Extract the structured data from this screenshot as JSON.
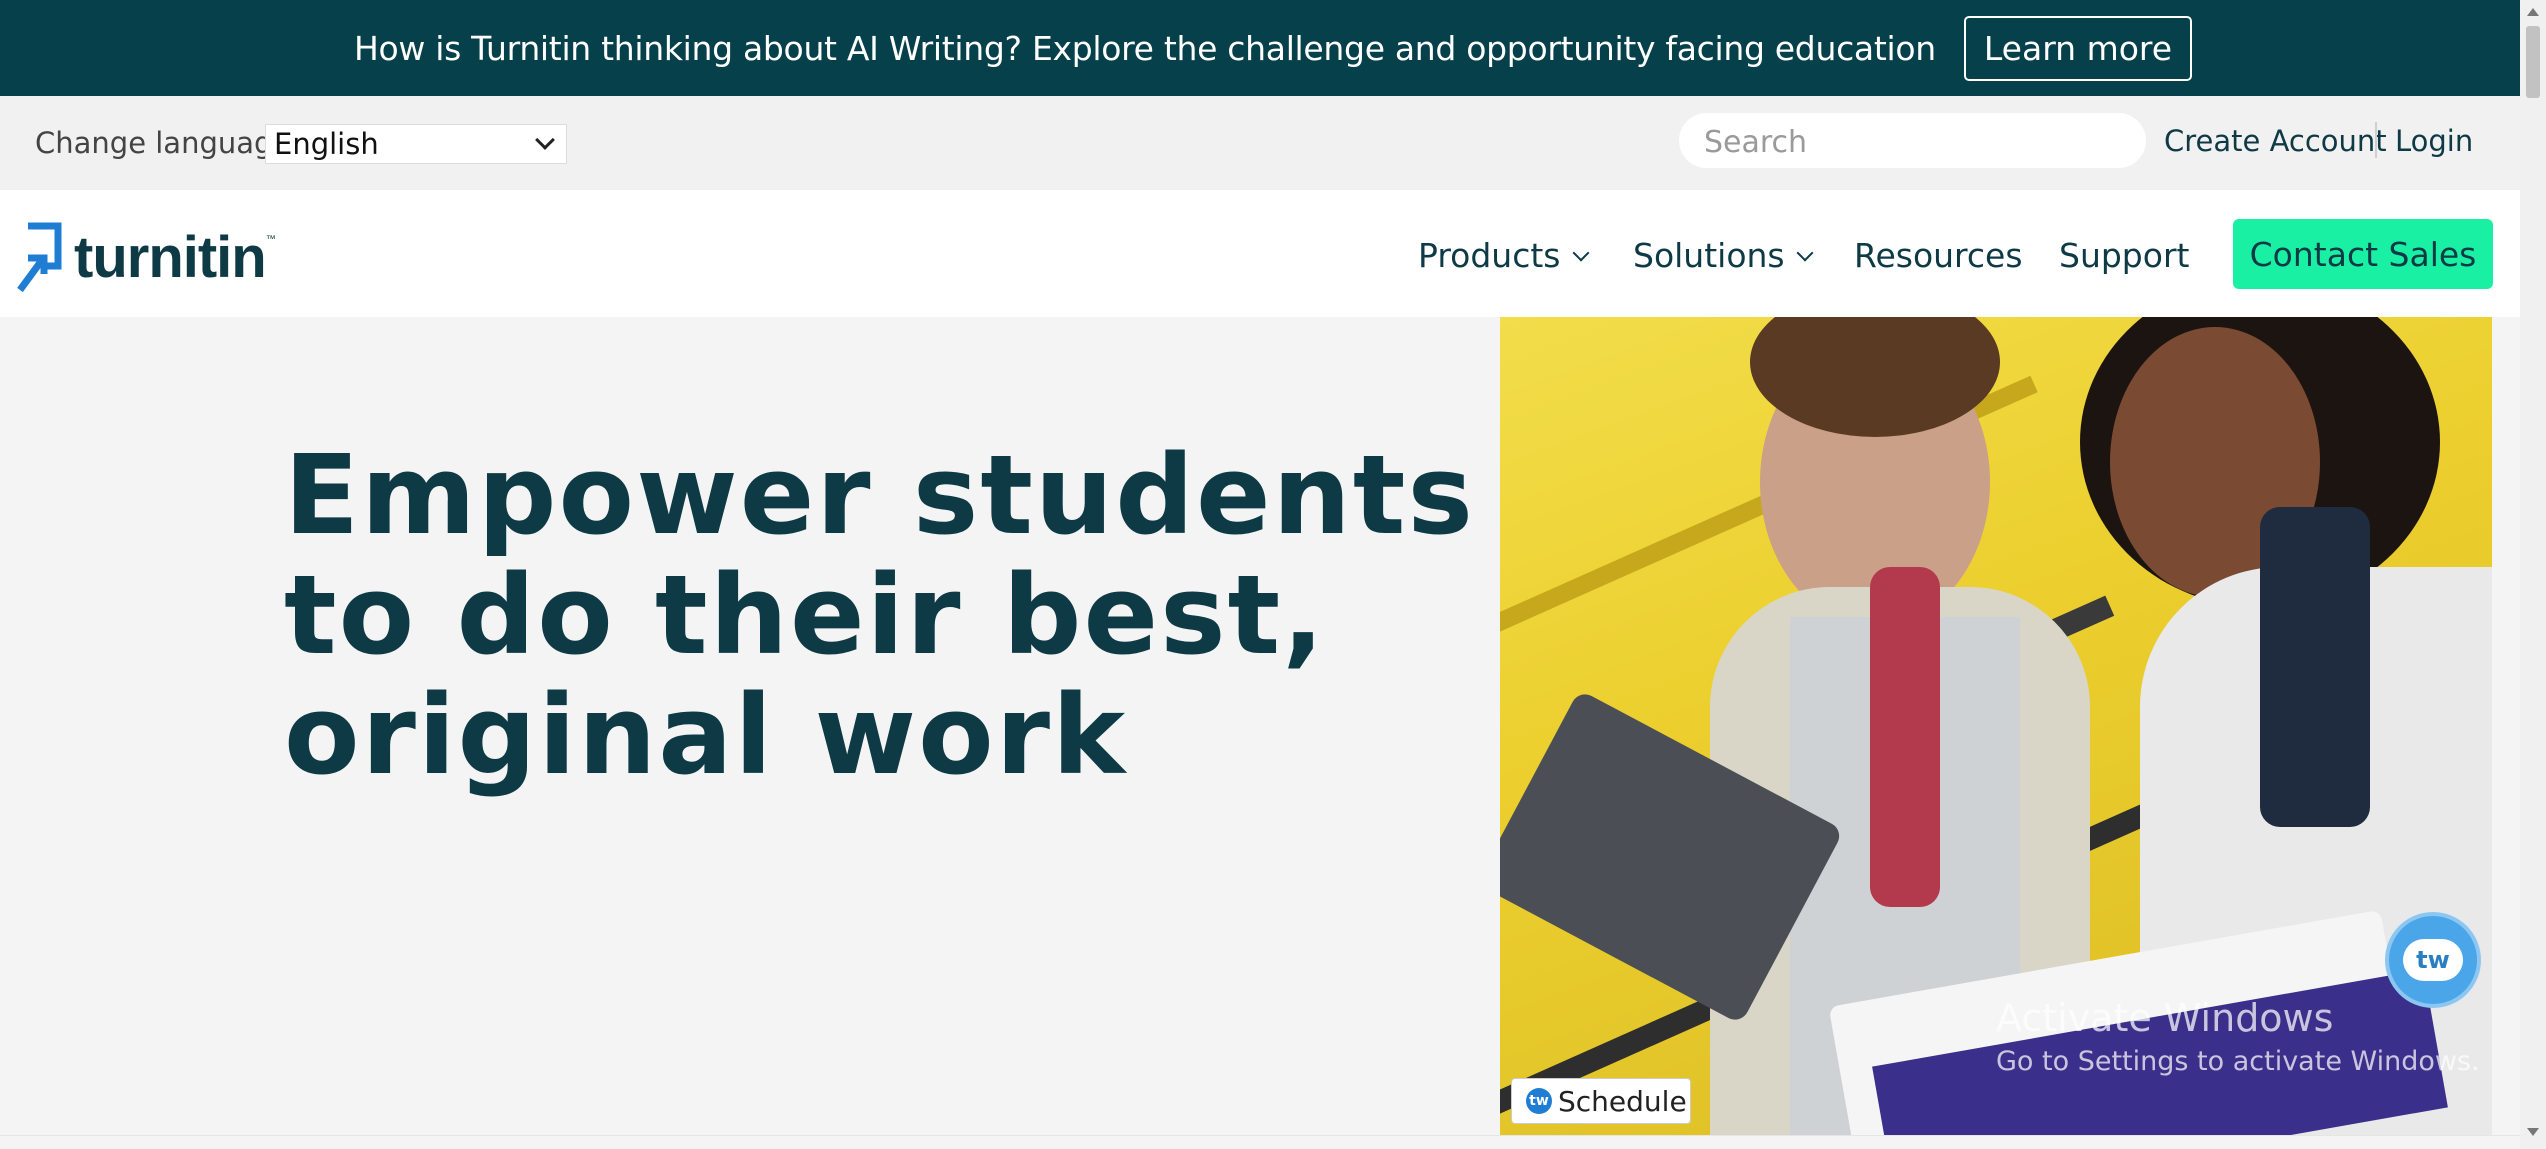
{
  "announcement": {
    "text": "How is Turnitin thinking about AI Writing? Explore the challenge and opportunity facing education",
    "button_label": "Learn more"
  },
  "utility": {
    "language_label": "Change language",
    "language_selected": "English",
    "search_placeholder": "Search",
    "create_account": "Create Account",
    "login": "Login"
  },
  "nav": {
    "logo_text": "turnitin",
    "logo_tm": "™",
    "items": [
      {
        "label": "Products",
        "has_dropdown": true
      },
      {
        "label": "Solutions",
        "has_dropdown": true
      },
      {
        "label": "Resources",
        "has_dropdown": false
      },
      {
        "label": "Support",
        "has_dropdown": false
      }
    ],
    "cta_label": "Contact Sales"
  },
  "hero": {
    "title_lines": [
      "Empower students",
      "to do their best,",
      "original work"
    ],
    "image_alt": "students-studying-photo"
  },
  "overlays": {
    "schedule_label": "Schedule",
    "schedule_badge": "tw",
    "chat_badge": "tw",
    "watermark_title": "Activate Windows",
    "watermark_sub": "Go to Settings to activate Windows."
  },
  "colors": {
    "brand_dark": "#06404a",
    "text_dark": "#0e3a45",
    "cta": "#19f0a3",
    "hero_bg": "#f4f4f4"
  }
}
